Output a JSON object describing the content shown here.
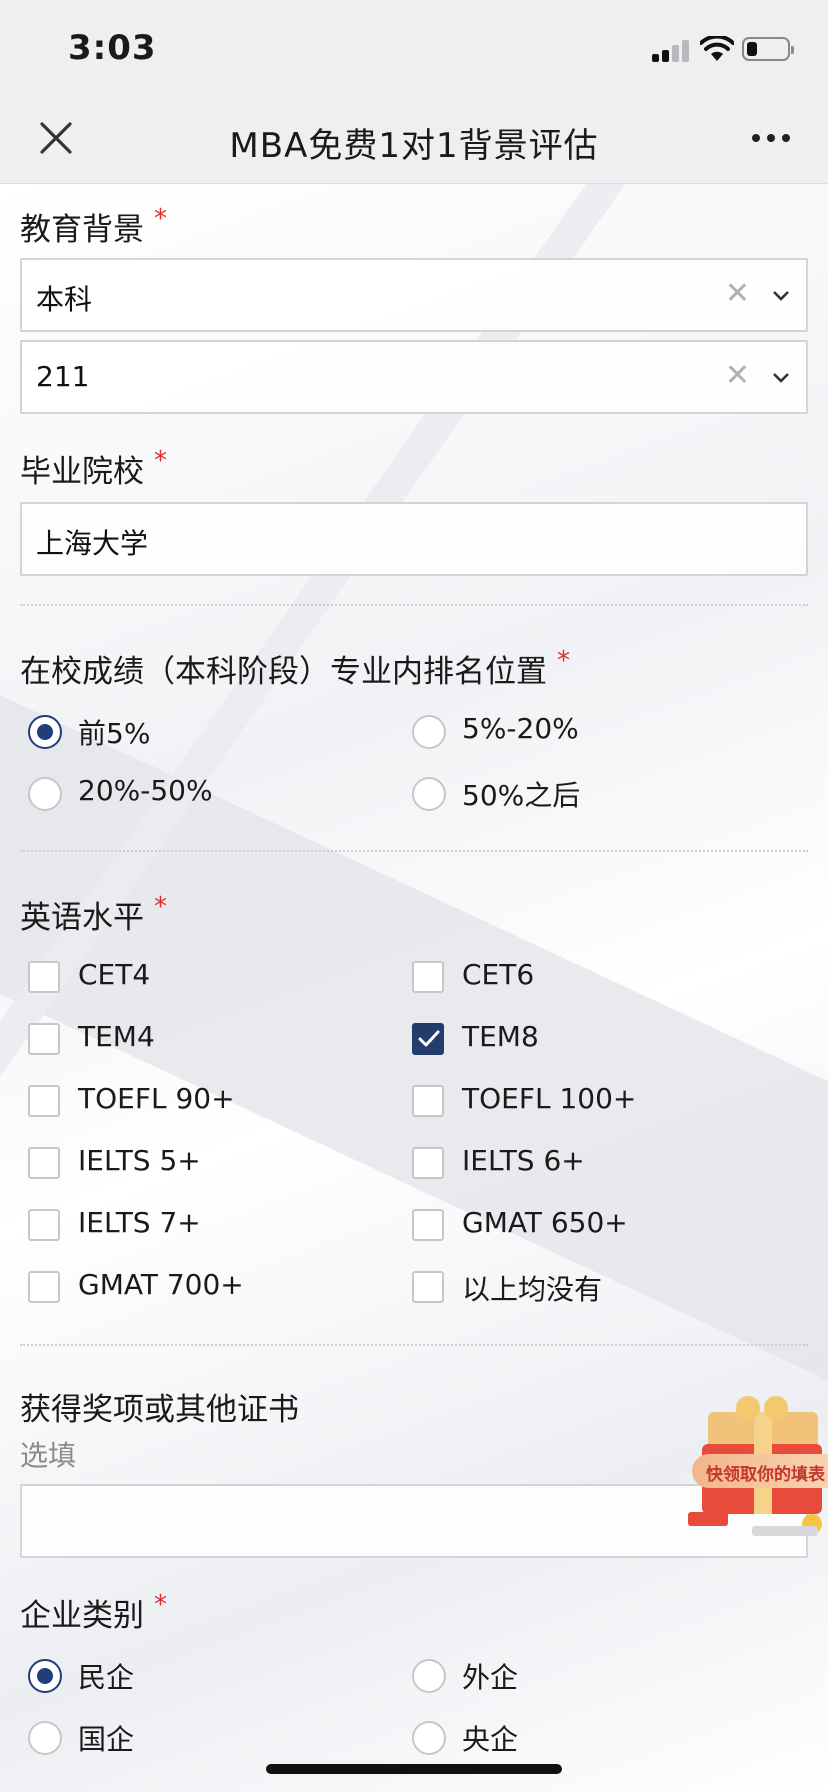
{
  "status_bar": {
    "time": "3:03"
  },
  "nav": {
    "title": "MBA免费1对1背景评估"
  },
  "education": {
    "label": "教育背景",
    "degree_value": "本科",
    "school_tier_value": "211"
  },
  "school": {
    "label": "毕业院校",
    "value": "上海大学"
  },
  "ranking": {
    "label": "在校成绩（本科阶段）专业内排名位置",
    "options": [
      {
        "label": "前5%",
        "selected": true
      },
      {
        "label": "5%-20%",
        "selected": false
      },
      {
        "label": "20%-50%",
        "selected": false
      },
      {
        "label": "50%之后",
        "selected": false
      }
    ]
  },
  "english": {
    "label": "英语水平",
    "options": [
      {
        "label": "CET4",
        "checked": false
      },
      {
        "label": "CET6",
        "checked": false
      },
      {
        "label": "TEM4",
        "checked": false
      },
      {
        "label": "TEM8",
        "checked": true
      },
      {
        "label": "TOEFL 90+",
        "checked": false
      },
      {
        "label": "TOEFL 100+",
        "checked": false
      },
      {
        "label": "IELTS 5+",
        "checked": false
      },
      {
        "label": "IELTS 6+",
        "checked": false
      },
      {
        "label": "IELTS 7+",
        "checked": false
      },
      {
        "label": "GMAT 650+",
        "checked": false
      },
      {
        "label": "GMAT 700+",
        "checked": false
      },
      {
        "label": "以上均没有",
        "checked": false
      }
    ]
  },
  "awards": {
    "label": "获得奖项或其他证书",
    "hint": "选填",
    "value": ""
  },
  "company_type": {
    "label": "企业类别",
    "options": [
      {
        "label": "民企",
        "selected": true
      },
      {
        "label": "外企",
        "selected": false
      },
      {
        "label": "国企",
        "selected": false
      },
      {
        "label": "央企",
        "selected": false
      }
    ]
  },
  "promo": {
    "text": "快领取你的填表"
  },
  "colors": {
    "accent": "#1f3d78",
    "required": "#d9302b"
  }
}
